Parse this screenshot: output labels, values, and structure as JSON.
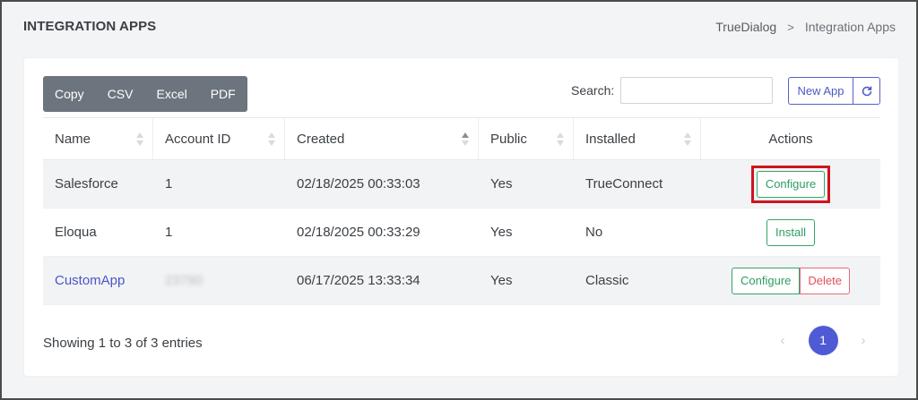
{
  "header": {
    "title": "INTEGRATION APPS",
    "breadcrumb": {
      "root": "TrueDialog",
      "separator": ">",
      "current": "Integration Apps"
    }
  },
  "toolbar": {
    "export_buttons": [
      "Copy",
      "CSV",
      "Excel",
      "PDF"
    ],
    "search_label": "Search:",
    "search_value": "",
    "new_app_label": "New App",
    "refresh_icon": "refresh-icon"
  },
  "table": {
    "columns": [
      "Name",
      "Account ID",
      "Created",
      "Public",
      "Installed",
      "Actions"
    ],
    "rows": [
      {
        "name": "Salesforce",
        "account_id": "1",
        "created": "02/18/2025 00:33:03",
        "public": "Yes",
        "installed": "TrueConnect",
        "actions": [
          "Configure"
        ]
      },
      {
        "name": "Eloqua",
        "account_id": "1",
        "created": "02/18/2025 00:33:29",
        "public": "Yes",
        "installed": "No",
        "actions": [
          "Install"
        ]
      },
      {
        "name": "CustomApp",
        "account_id": "23790",
        "created": "06/17/2025 13:33:34",
        "public": "Yes",
        "installed": "Classic",
        "actions": [
          "Configure",
          "Delete"
        ]
      }
    ]
  },
  "footer": {
    "info": "Showing 1 to 3 of 3 entries",
    "pagination": {
      "prev": "‹",
      "current_page": "1",
      "next": "›"
    }
  },
  "colors": {
    "accent": "#4f5bd5",
    "success": "#34a56a",
    "danger": "#e2505a",
    "highlight": "#d0141d",
    "export_group": "#6c757d"
  }
}
